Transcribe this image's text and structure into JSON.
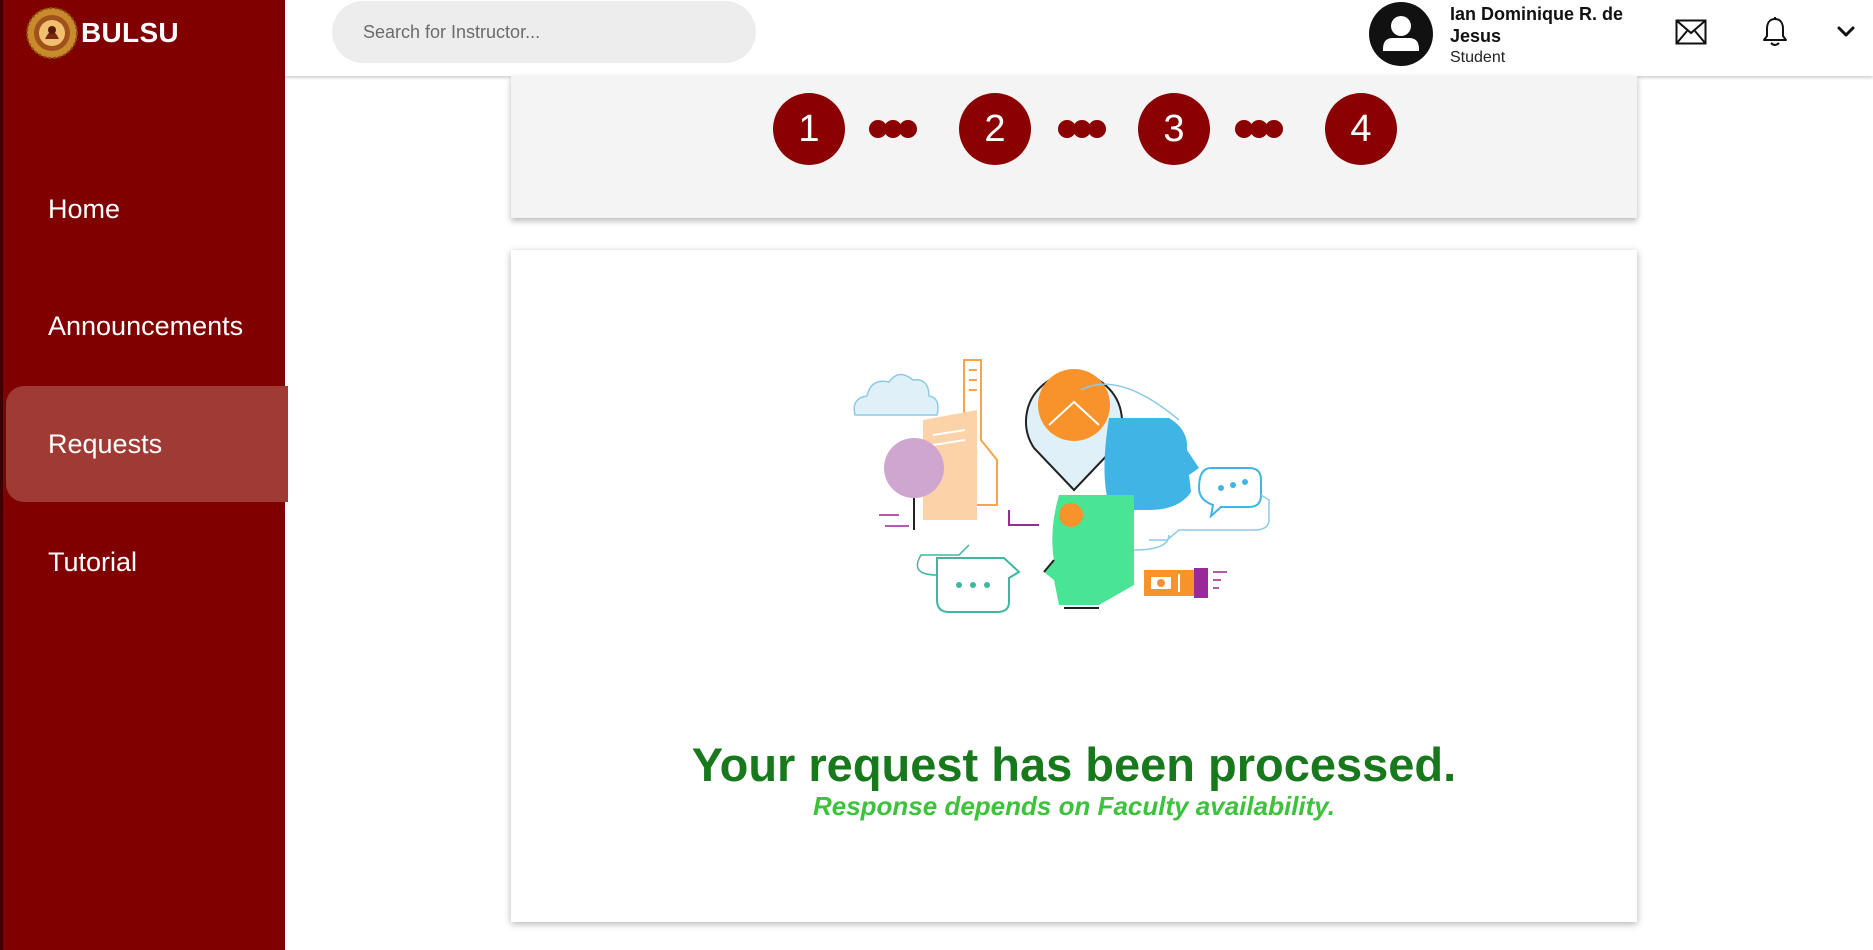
{
  "brand": {
    "name": "BULSU"
  },
  "sidebar": {
    "items": [
      {
        "label": "Home",
        "active": false
      },
      {
        "label": "Announcements",
        "active": false
      },
      {
        "label": "Requests",
        "active": true
      },
      {
        "label": "Tutorial",
        "active": false
      }
    ]
  },
  "header": {
    "search": {
      "placeholder": "Search for Instructor...",
      "value": ""
    },
    "user": {
      "name": "Ian Dominique R. de Jesus",
      "role": "Student"
    },
    "icons": [
      "mail-icon",
      "bell-icon",
      "chevron-down-icon"
    ]
  },
  "steps": [
    "1",
    "2",
    "3",
    "4"
  ],
  "result": {
    "title": "Your request has been processed.",
    "subtitle": "Response depends on Faculty availability."
  },
  "colors": {
    "sidebar": "#800000",
    "sidebar_active": "#9f3b34",
    "step": "#8b0000",
    "title_green": "#18781c",
    "subtitle_green": "#3cc23b"
  }
}
